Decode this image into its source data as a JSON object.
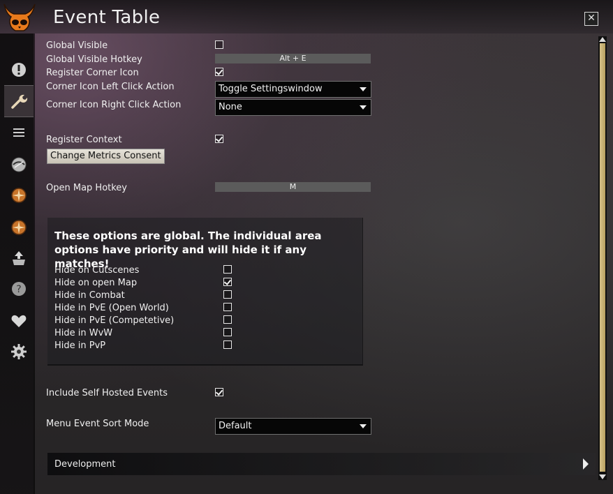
{
  "window": {
    "title": "Event Table",
    "close_glyph": "✕"
  },
  "sidebar": {
    "items": [
      {
        "icon": "alert-icon",
        "glyph": "!"
      },
      {
        "icon": "wrench-icon",
        "glyph": "🔧"
      },
      {
        "icon": "list-icon",
        "glyph": "≡"
      },
      {
        "icon": "gem-icon",
        "glyph": "◆"
      },
      {
        "icon": "compass-icon",
        "glyph": "✹"
      },
      {
        "icon": "compass-icon",
        "glyph": "✹"
      },
      {
        "icon": "upload-icon",
        "glyph": "⇪"
      },
      {
        "icon": "help-icon",
        "glyph": "?"
      },
      {
        "icon": "heart-icon",
        "glyph": "♥"
      },
      {
        "icon": "gear-icon",
        "glyph": "⚙"
      }
    ]
  },
  "settings": {
    "global_visible": {
      "label": "Global Visible",
      "checked": false
    },
    "global_visible_hotkey": {
      "label": "Global Visible Hotkey",
      "value": "Alt + E"
    },
    "register_corner_icon": {
      "label": "Register Corner Icon",
      "checked": true
    },
    "corner_left_click": {
      "label": "Corner Icon Left Click Action",
      "value": "Toggle Settingswindow"
    },
    "corner_right_click": {
      "label": "Corner Icon Right Click Action",
      "value": "None"
    },
    "register_context": {
      "label": "Register Context",
      "checked": true
    },
    "change_metrics_consent": {
      "label": "Change Metrics Consent"
    },
    "open_map_hotkey": {
      "label": "Open Map Hotkey",
      "value": "M"
    },
    "include_self_hosted": {
      "label": "Include Self Hosted Events",
      "checked": true
    },
    "menu_event_sort_mode": {
      "label": "Menu Event Sort Mode",
      "value": "Default"
    }
  },
  "global_options": {
    "title": "These options are global. The individual area options have priority and will hide it if any matches!",
    "items": [
      {
        "label": "Hide on Cutscenes",
        "checked": false
      },
      {
        "label": "Hide on open Map",
        "checked": true
      },
      {
        "label": "Hide in Combat",
        "checked": false
      },
      {
        "label": "Hide in PvE (Open World)",
        "checked": false
      },
      {
        "label": "Hide in PvE (Competetive)",
        "checked": false
      },
      {
        "label": "Hide in WvW",
        "checked": false
      },
      {
        "label": "Hide in PvP",
        "checked": false
      }
    ]
  },
  "development": {
    "label": "Development"
  }
}
